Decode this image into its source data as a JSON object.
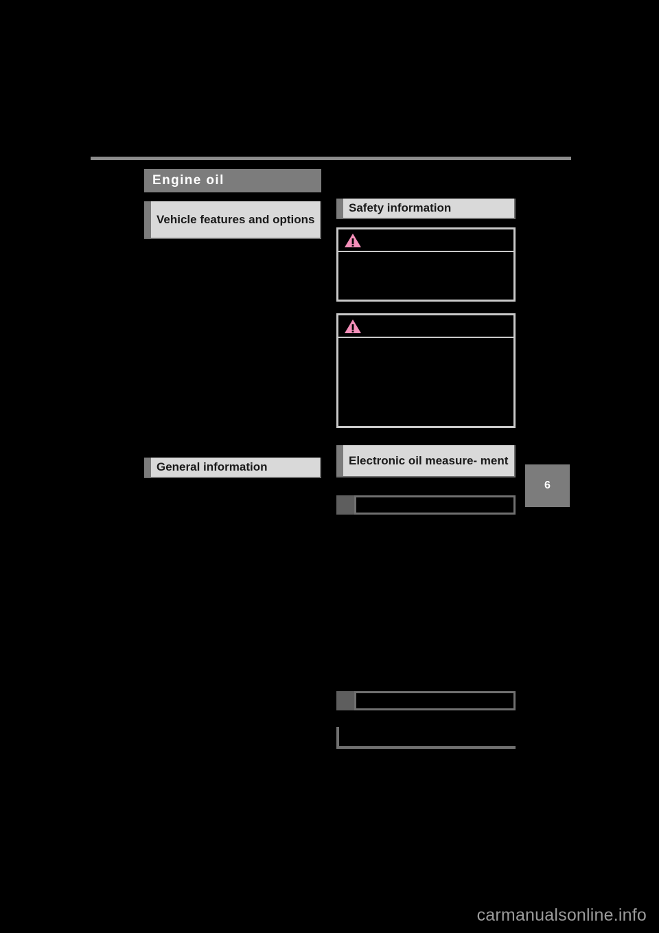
{
  "page": {
    "background_color": "#000000",
    "chapter_number": "6",
    "watermark": "carmanualsonline.info"
  },
  "colors": {
    "chapter_bar_bg": "#7c7c7c",
    "section_header_bg": "#d9d9d9",
    "section_tab": "#7c7c7c",
    "rule": "#8c8c8c",
    "warning_border": "#c9c9c9",
    "warning_icon": "#f48fb9",
    "subhead_square": "#5e5e5e",
    "subhead_border": "#707070",
    "watermark_text": "#9a9a9a"
  },
  "chapter": {
    "title": "Engine oil"
  },
  "left_column": {
    "sections": [
      {
        "id": "vehicle-features-and-options",
        "title": "Vehicle features and options"
      },
      {
        "id": "general-information",
        "title": "General information"
      }
    ]
  },
  "right_column": {
    "sections": [
      {
        "id": "safety-information",
        "title": "Safety information"
      },
      {
        "id": "electronic-oil-measurement",
        "title": "Electronic oil measure-\nment"
      }
    ],
    "warnings": [
      {
        "id": "warning-1",
        "icon": "warning-triangle-icon",
        "heading": "",
        "body": ""
      },
      {
        "id": "warning-2",
        "icon": "warning-triangle-icon",
        "heading": "",
        "body": ""
      }
    ],
    "subheads": [
      {
        "id": "subhead-1",
        "label": ""
      },
      {
        "id": "subhead-2",
        "label": ""
      }
    ],
    "notice": {
      "id": "notice-bracket",
      "label": ""
    }
  },
  "body_text": {
    "left_block_1": "",
    "left_block_2": "",
    "right_block_1": "",
    "right_block_2": ""
  }
}
